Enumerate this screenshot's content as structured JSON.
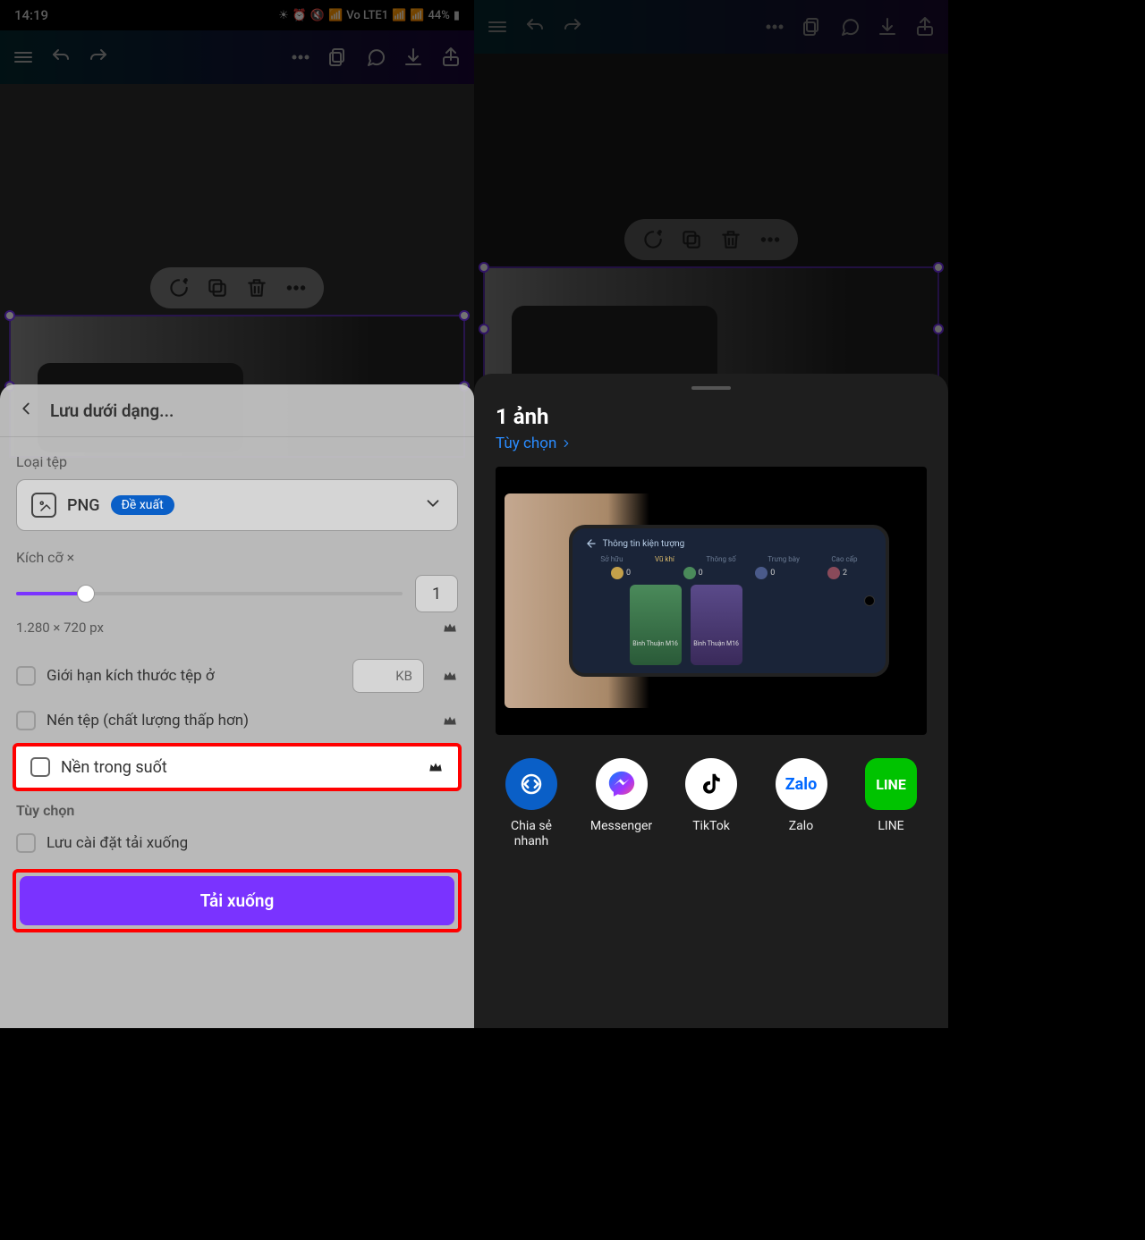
{
  "status": {
    "time": "14:19",
    "battery": "44%",
    "network_label": "Vo LTE1"
  },
  "toolbar_icons": [
    "menu",
    "undo",
    "redo",
    "more",
    "layers",
    "comment",
    "download",
    "share"
  ],
  "element_toolbar_icons": [
    "magic",
    "duplicate",
    "delete",
    "more"
  ],
  "left": {
    "sheet_title": "Lưu dưới dạng...",
    "file_type_label": "Loại tệp",
    "file_type_value": "PNG",
    "file_type_badge": "Đề xuất",
    "size_label": "Kích cỡ ×",
    "size_value": "1",
    "dimensions": "1.280 × 720 px",
    "limit_label": "Giới hạn kích thước tệp ở",
    "kb_label": "KB",
    "compress_label": "Nén tệp (chất lượng thấp hơn)",
    "transparent_label": "Nền trong suốt",
    "options_label": "Tùy chọn",
    "save_settings_label": "Lưu cài đặt tải xuống",
    "download_btn": "Tải xuống"
  },
  "right": {
    "title": "1 ảnh",
    "subtitle": "Tùy chọn",
    "game_header": "Thông tin kiện tượng",
    "game_tabs": [
      "Sở hữu",
      "Vũ khí",
      "Thông số",
      "Trưng bày",
      "Cao cấp"
    ],
    "game_cards": [
      "Bình Thuận M16",
      "Bình Thuận M16"
    ],
    "share_apps": [
      {
        "name": "Chia sẻ nhanh",
        "icon": "share"
      },
      {
        "name": "Messenger",
        "icon": "messenger"
      },
      {
        "name": "TikTok",
        "icon": "tiktok"
      },
      {
        "name": "Zalo",
        "icon": "zalo"
      },
      {
        "name": "LINE",
        "icon": "line"
      }
    ]
  }
}
